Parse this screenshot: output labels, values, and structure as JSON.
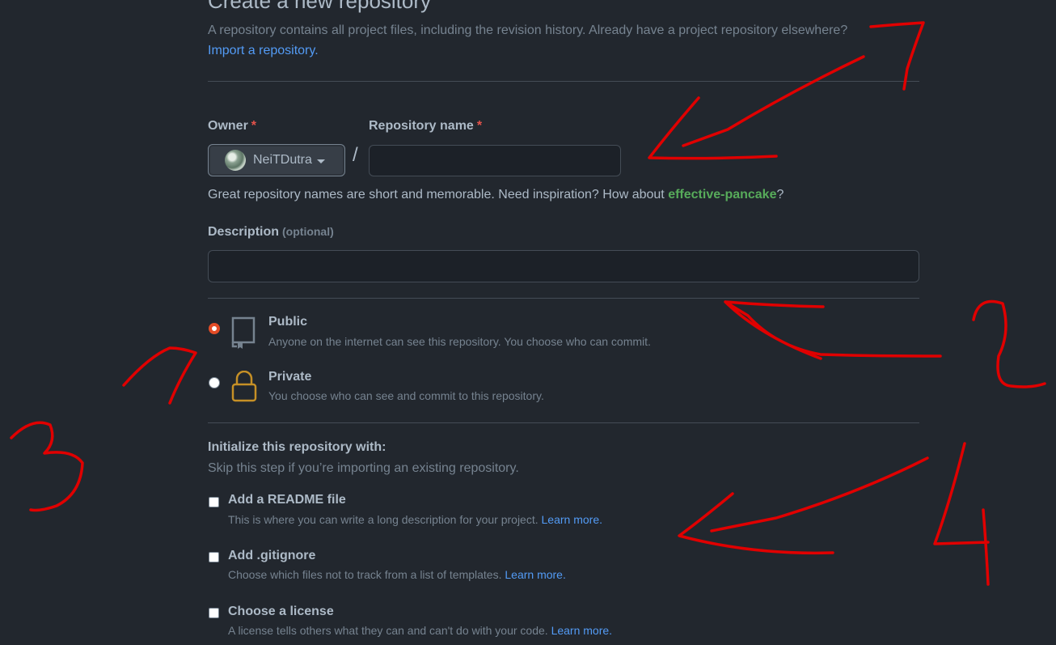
{
  "header": {
    "title": "Create a new repository",
    "subtitle": "A repository contains all project files, including the revision history. Already have a project repository elsewhere?",
    "import_link": "Import a repository."
  },
  "owner": {
    "label": "Owner",
    "required_mark": "*",
    "value": "NeiTDutra"
  },
  "separator": "/",
  "repo_name": {
    "label": "Repository name",
    "required_mark": "*",
    "value": ""
  },
  "hint": {
    "text": "Great repository names are short and memorable. Need inspiration? How about ",
    "suggestion": "effective-pancake",
    "end": "?"
  },
  "description": {
    "label": "Description",
    "optional": "(optional)",
    "value": ""
  },
  "visibility": {
    "selected": "public",
    "public": {
      "title": "Public",
      "desc": "Anyone on the internet can see this repository. You choose who can commit."
    },
    "private": {
      "title": "Private",
      "desc": "You choose who can see and commit to this repository."
    }
  },
  "init": {
    "title": "Initialize this repository with:",
    "subtitle": "Skip this step if you’re importing an existing repository.",
    "readme": {
      "title": "Add a README file",
      "desc": "This is where you can write a long description for your project.",
      "link": "Learn more."
    },
    "gitignore": {
      "title": "Add .gitignore",
      "desc": "Choose which files not to track from a list of templates.",
      "link": "Learn more."
    },
    "license": {
      "title": "Choose a license",
      "desc": "A license tells others what they can and can't do with your code.",
      "link": "Learn more."
    }
  },
  "colors": {
    "background": "#22272e",
    "link": "#539bf5",
    "suggestion": "#57ab5a",
    "required": "#e5534b",
    "annotation": "#e00000",
    "lock_icon": "#c69026"
  }
}
